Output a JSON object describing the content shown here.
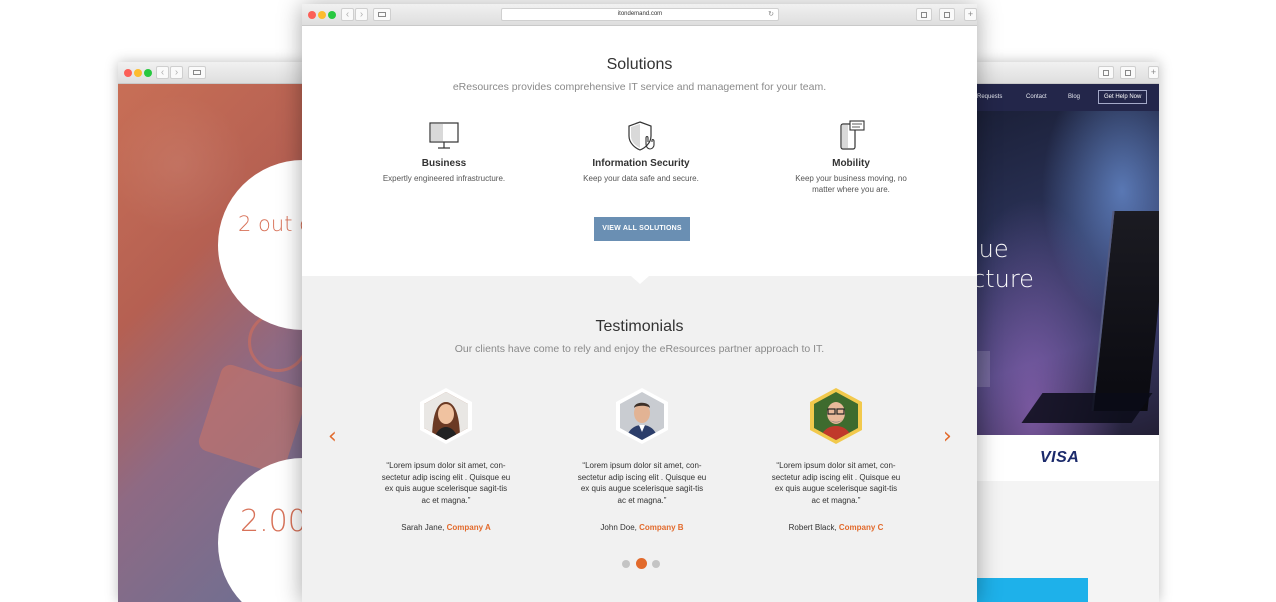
{
  "back_left": {
    "circle1_text": "2 out o",
    "circle2_text": "2.00"
  },
  "back_right": {
    "nav": {
      "requests": "e Requests",
      "contact": "Contact",
      "blog": "Blog",
      "cta": "Get Help Now"
    },
    "hero_line1": "lue",
    "hero_line2": "cture",
    "logo": "VISA"
  },
  "front": {
    "url": "itondemand.com",
    "solutions": {
      "title": "Solutions",
      "subtitle": "eResources provides comprehensive IT service and management for your team.",
      "features": [
        {
          "icon": "monitor-icon",
          "title": "Business",
          "desc": "Expertly engineered infrastructure."
        },
        {
          "icon": "shield-icon",
          "title": "Information Security",
          "desc": "Keep your data safe and secure."
        },
        {
          "icon": "mobile-icon",
          "title": "Mobility",
          "desc": "Keep your business moving, no matter where you are."
        }
      ],
      "cta": "VIEW ALL SOLUTIONS"
    },
    "testimonials": {
      "title": "Testimonials",
      "subtitle": "Our clients have come to rely and enjoy the eResources partner approach to IT.",
      "prev": "‹",
      "next": "›",
      "items": [
        {
          "quote": "“Lorem ipsum dolor sit amet, con-sectetur adip iscing elit . Quisque eu ex quis augue scelerisque sagit-tis ac et magna.”",
          "name": "Sarah Jane, ",
          "company": "Company A"
        },
        {
          "quote": "“Lorem ipsum dolor sit amet, con-sectetur adip iscing elit . Quisque eu ex quis augue scelerisque sagit-tis ac et magna.”",
          "name": "John Doe, ",
          "company": "Company B"
        },
        {
          "quote": "“Lorem ipsum dolor sit amet, con-sectetur adip iscing elit . Quisque eu ex quis augue scelerisque sagit-tis ac et magna.”",
          "name": "Robert Black, ",
          "company": "Company C"
        }
      ],
      "active_page": 2,
      "page_count": 3
    }
  }
}
